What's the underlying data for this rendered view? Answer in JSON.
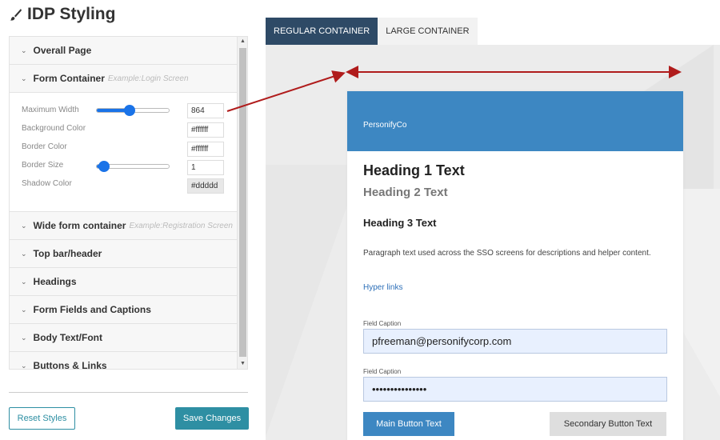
{
  "app": {
    "title": "IDP Styling"
  },
  "accordion": {
    "overall_page": "Overall Page",
    "form_container": {
      "label": "Form Container",
      "example": "Example:Login Screen"
    },
    "fields": {
      "max_width_label": "Maximum Width",
      "max_width_value": "864",
      "max_width_level": 0.45,
      "bg_color_label": "Background Color",
      "bg_color_value": "#ffffff",
      "border_color_label": "Border Color",
      "border_color_value": "#ffffff",
      "border_size_label": "Border Size",
      "border_size_value": "1",
      "border_size_level": 0.1,
      "shadow_color_label": "Shadow Color",
      "shadow_color_value": "#ddddd"
    },
    "wide_form": {
      "label": "Wide form container",
      "example": "Example:Registration Screen"
    },
    "top_bar": "Top bar/header",
    "headings": "Headings",
    "form_fields": "Form Fields and Captions",
    "body_text": "Body Text/Font",
    "buttons_links": "Buttons & Links"
  },
  "actions": {
    "reset": "Reset Styles",
    "save": "Save Changes"
  },
  "preview": {
    "tabs": [
      "REGULAR CONTAINER",
      "LARGE CONTAINER"
    ],
    "brand": "PersonifyCo",
    "h1": "Heading 1 Text",
    "h2": "Heading 2 Text",
    "h3": "Heading 3 Text",
    "paragraph": "Paragraph text used across the SSO screens for descriptions and helper content.",
    "link": "Hyper links",
    "caption1": "Field Caption",
    "email_value": "pfreeman@personifycorp.com",
    "caption2": "Field Caption",
    "password_value": "•••••••••••••••",
    "main_button": "Main Button Text",
    "secondary_button": "Secondary Button Text"
  },
  "colors": {
    "accent": "#2e8fa3",
    "header_blue": "#3d87c2",
    "tab_active": "#2e4a66",
    "arrow_red": "#b01c1c"
  }
}
